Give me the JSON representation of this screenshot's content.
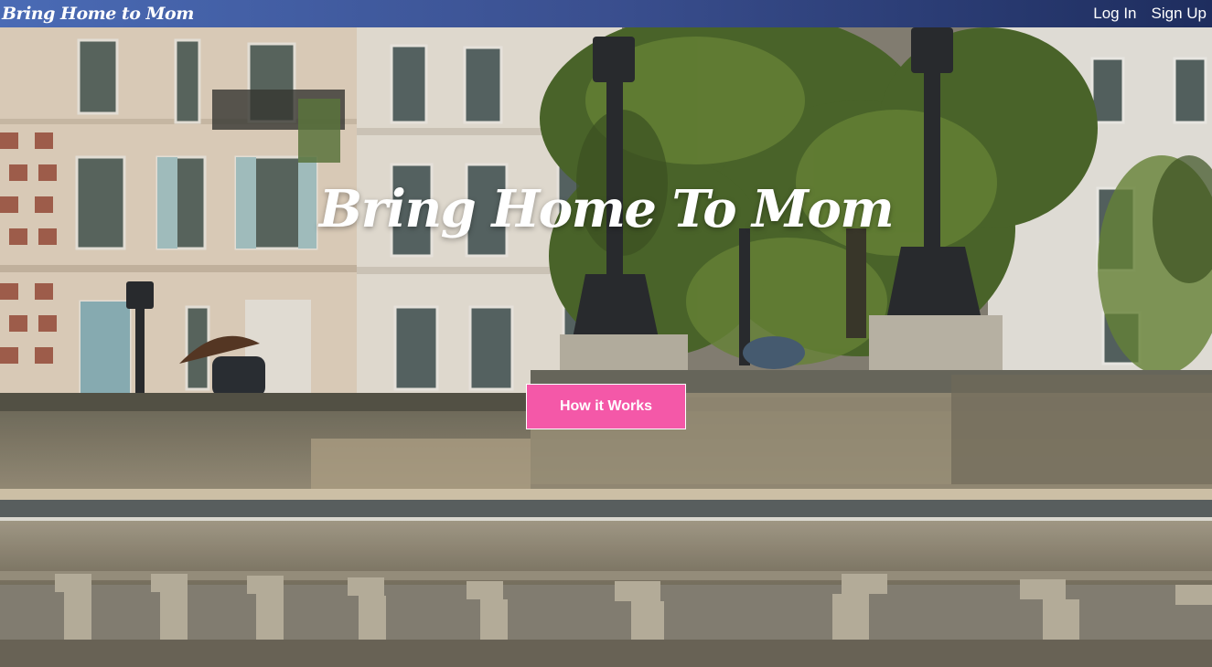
{
  "navbar": {
    "brand": "Bring Home to Mom",
    "links": [
      {
        "label": "Log In"
      },
      {
        "label": "Sign Up"
      }
    ]
  },
  "hero": {
    "title": "Bring Home To Mom",
    "cta_label": "How it Works"
  },
  "colors": {
    "navbar_start": "#4a6bb5",
    "navbar_end": "#1e2d5e",
    "cta_background": "#f458a8",
    "text": "#ffffff"
  }
}
